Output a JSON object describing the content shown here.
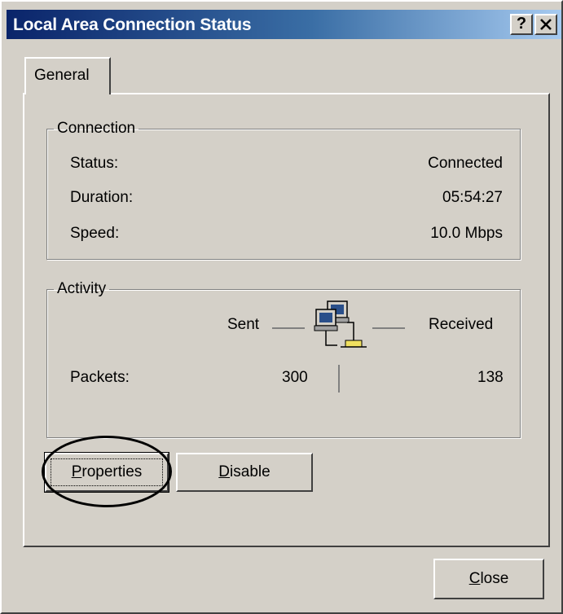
{
  "window": {
    "title": "Local Area Connection Status",
    "help_label": "?",
    "close_label": "✕"
  },
  "tabs": [
    {
      "label": "General",
      "selected": true
    }
  ],
  "connection": {
    "legend": "Connection",
    "rows": [
      {
        "label": "Status:",
        "value": "Connected"
      },
      {
        "label": "Duration:",
        "value": "05:54:27"
      },
      {
        "label": "Speed:",
        "value": "10.0 Mbps"
      }
    ]
  },
  "activity": {
    "legend": "Activity",
    "sent_label": "Sent",
    "received_label": "Received",
    "packets_label": "Packets:",
    "packets_sent": "300",
    "packets_received": "138",
    "icon": "network-computers-icon"
  },
  "buttons": {
    "properties_prefix": "",
    "properties_accel": "P",
    "properties_rest": "roperties",
    "disable_prefix": "",
    "disable_accel": "D",
    "disable_rest": "isable",
    "close_prefix": "",
    "close_accel": "C",
    "close_rest": "lose"
  },
  "colors": {
    "titlebar_start": "#0a246a",
    "titlebar_end": "#a6caf0",
    "face": "#d4d0c8"
  }
}
